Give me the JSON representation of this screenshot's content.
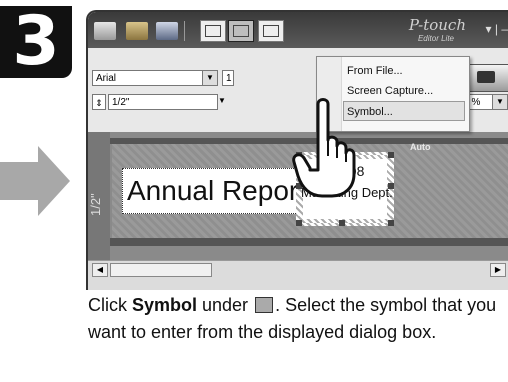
{
  "step": {
    "number": "3"
  },
  "toolbar": {
    "font": "Arial",
    "size": "1",
    "tape_length": "1/2\"",
    "zoom": "100 %"
  },
  "logo": {
    "name": "P-touch",
    "sub": "Editor Lite"
  },
  "menu": {
    "items": [
      "From File...",
      "Screen Capture...",
      "Symbol..."
    ],
    "selected": "Symbol..."
  },
  "label": {
    "ruler": "1/2\"",
    "title": "Annual Report",
    "small_line1": "008",
    "small_line2": "Marketing Dept.",
    "auto": "Auto"
  },
  "instructions": {
    "p1": "Click ",
    "bold": "Symbol",
    "p2": " under ",
    "p3": ". Select the symbol that you want to enter from the displayed dialog box."
  },
  "colors": {
    "menu_selected": "#e2e2e2",
    "titlebar": "#3a3a3a",
    "arrow": "#a8a8a8"
  }
}
